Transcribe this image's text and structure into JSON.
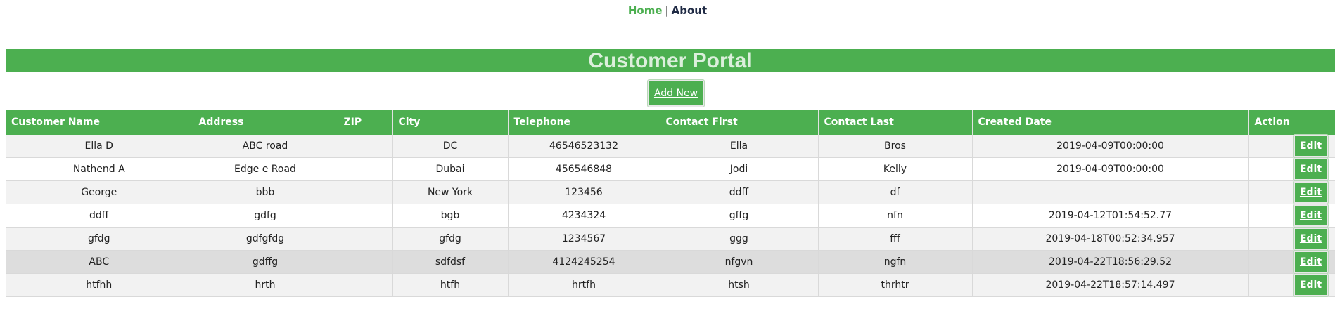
{
  "nav": {
    "home": "Home",
    "separator": "|",
    "about": "About"
  },
  "banner": {
    "title": "Customer Portal"
  },
  "toolbar": {
    "add_new_label": "Add New"
  },
  "table": {
    "headers": [
      "Customer Name",
      "Address",
      "ZIP",
      "City",
      "Telephone",
      "Contact First",
      "Contact Last",
      "Created Date",
      "Action"
    ],
    "edit_label": "Edit",
    "rows": [
      [
        "Ella D",
        "ABC road",
        "",
        "DC",
        "46546523132",
        "Ella",
        "Bros",
        "2019-04-09T00:00:00"
      ],
      [
        "Nathend A",
        "Edge e Road",
        "",
        "Dubai",
        "456546848",
        "Jodi",
        "Kelly",
        "2019-04-09T00:00:00"
      ],
      [
        "George",
        "bbb",
        "",
        "New York",
        "123456",
        "ddff",
        "df",
        ""
      ],
      [
        "ddff",
        "gdfg",
        "",
        "bgb",
        "4234324",
        "gffg",
        "nfn",
        "2019-04-12T01:54:52.77"
      ],
      [
        "gfdg",
        "gdfgfdg",
        "",
        "gfdg",
        "1234567",
        "ggg",
        "fff",
        "2019-04-18T00:52:34.957"
      ],
      [
        "ABC",
        "gdffg",
        "",
        "sdfdsf",
        "4124245254",
        "nfgvn",
        "ngfn",
        "2019-04-22T18:56:29.52"
      ],
      [
        "htfhh",
        "hrth",
        "",
        "htfh",
        "hrtfh",
        "htsh",
        "thrhtr",
        "2019-04-22T18:57:14.497"
      ]
    ]
  }
}
